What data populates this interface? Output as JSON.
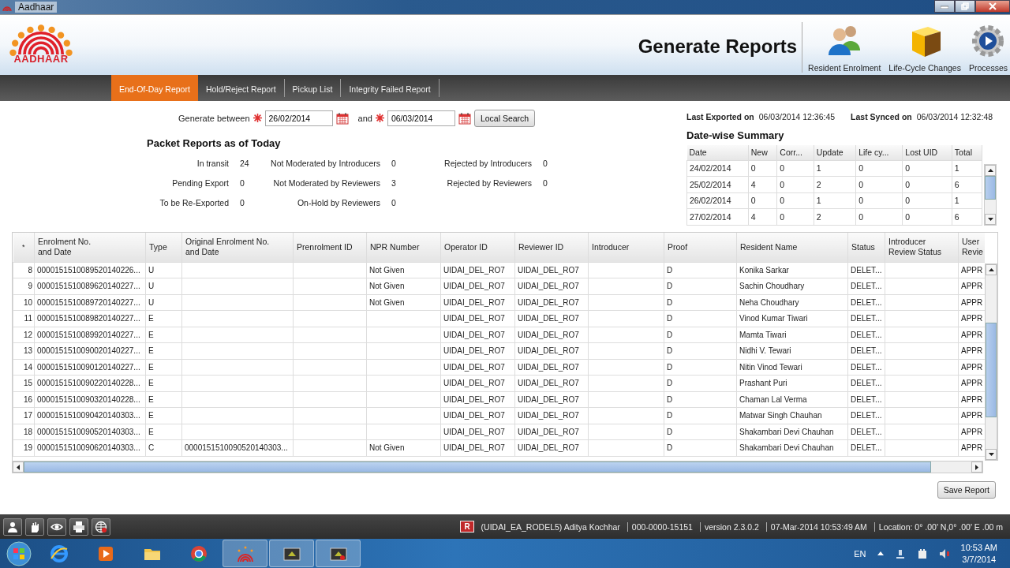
{
  "window": {
    "title": "Aadhaar"
  },
  "header": {
    "logo_text": "AADHAAR",
    "title": "Generate Reports",
    "actions": [
      {
        "kind": "people",
        "label": "Resident Enrolment"
      },
      {
        "kind": "cube",
        "label": "Life-Cycle Changes"
      },
      {
        "kind": "gear",
        "label": "Processes"
      }
    ]
  },
  "tabs": [
    {
      "label": "End-Of-Day Report",
      "selected": true
    },
    {
      "label": "Hold/Reject Report",
      "selected": false
    },
    {
      "label": "Pickup List",
      "selected": false
    },
    {
      "label": "Integrity Failed Report",
      "selected": false
    }
  ],
  "filter": {
    "label": "Generate between",
    "from": "26/02/2014",
    "and_label": "and",
    "to": "06/03/2014",
    "button": "Local Search"
  },
  "export_info": [
    {
      "label": "Last Exported on",
      "value": "06/03/2014 12:36:45"
    },
    {
      "label": "Last Synced on",
      "value": "06/03/2014 12:32:48"
    }
  ],
  "packet_reports": {
    "title": "Packet Reports as of Today",
    "items": [
      {
        "label": "In transit",
        "value": "24"
      },
      {
        "label": "Not Moderated by Introducers",
        "value": "0"
      },
      {
        "label": "Rejected by Introducers",
        "value": "0"
      },
      {
        "label": "Pending Export",
        "value": "0"
      },
      {
        "label": "Not Moderated by Reviewers",
        "value": "3"
      },
      {
        "label": "Rejected by Reviewers",
        "value": "0"
      },
      {
        "label": "To be Re-Exported",
        "value": "0"
      },
      {
        "label": "On-Hold by Reviewers",
        "value": "0"
      }
    ]
  },
  "summary": {
    "title": "Date-wise Summary",
    "columns": [
      "Date",
      "New",
      "Corr...",
      "Update",
      "Life cy...",
      "Lost UID",
      "Total"
    ],
    "rows": [
      [
        "24/02/2014",
        "0",
        "0",
        "1",
        "0",
        "0",
        "1"
      ],
      [
        "25/02/2014",
        "4",
        "0",
        "2",
        "0",
        "0",
        "6"
      ],
      [
        "26/02/2014",
        "0",
        "0",
        "1",
        "0",
        "0",
        "1"
      ],
      [
        "27/02/2014",
        "4",
        "0",
        "2",
        "0",
        "0",
        "6"
      ]
    ]
  },
  "records": {
    "columns": [
      "*",
      "Enrolment No.\nand Date",
      "Type",
      "Original Enrolment No.\nand Date",
      "Prenrolment ID",
      "NPR Number",
      "Operator ID",
      "Reviewer ID",
      "Introducer",
      "Proof",
      "Resident Name",
      "Status",
      "Introducer\nReview Status",
      "User\nRevie"
    ],
    "rows": [
      [
        "8",
        "0000151510089520140226...",
        "U",
        null,
        null,
        "Not Given",
        "UIDAI_DEL_RO7",
        "UIDAI_DEL_RO7",
        null,
        "D",
        "Konika Sarkar",
        "DELET...",
        null,
        "APPR"
      ],
      [
        "9",
        "0000151510089620140227...",
        "U",
        null,
        null,
        "Not Given",
        "UIDAI_DEL_RO7",
        "UIDAI_DEL_RO7",
        null,
        "D",
        "Sachin Choudhary",
        "DELET...",
        null,
        "APPR"
      ],
      [
        "10",
        "0000151510089720140227...",
        "U",
        null,
        null,
        "Not Given",
        "UIDAI_DEL_RO7",
        "UIDAI_DEL_RO7",
        null,
        "D",
        "Neha Choudhary",
        "DELET...",
        null,
        "APPR"
      ],
      [
        "11",
        "0000151510089820140227...",
        "E",
        null,
        null,
        null,
        "UIDAI_DEL_RO7",
        "UIDAI_DEL_RO7",
        null,
        "D",
        "Vinod Kumar Tiwari",
        "DELET...",
        null,
        "APPR"
      ],
      [
        "12",
        "0000151510089920140227...",
        "E",
        null,
        null,
        null,
        "UIDAI_DEL_RO7",
        "UIDAI_DEL_RO7",
        null,
        "D",
        "Mamta Tiwari",
        "DELET...",
        null,
        "APPR"
      ],
      [
        "13",
        "0000151510090020140227...",
        "E",
        null,
        null,
        null,
        "UIDAI_DEL_RO7",
        "UIDAI_DEL_RO7",
        null,
        "D",
        "Nidhi V. Tewari",
        "DELET...",
        null,
        "APPR"
      ],
      [
        "14",
        "0000151510090120140227...",
        "E",
        null,
        null,
        null,
        "UIDAI_DEL_RO7",
        "UIDAI_DEL_RO7",
        null,
        "D",
        "Nitin Vinod Tewari",
        "DELET...",
        null,
        "APPR"
      ],
      [
        "15",
        "0000151510090220140228...",
        "E",
        null,
        null,
        null,
        "UIDAI_DEL_RO7",
        "UIDAI_DEL_RO7",
        null,
        "D",
        "Prashant Puri",
        "DELET...",
        null,
        "APPR"
      ],
      [
        "16",
        "0000151510090320140228...",
        "E",
        null,
        null,
        null,
        "UIDAI_DEL_RO7",
        "UIDAI_DEL_RO7",
        null,
        "D",
        "Chaman Lal Verma",
        "DELET...",
        null,
        "APPR"
      ],
      [
        "17",
        "0000151510090420140303...",
        "E",
        null,
        null,
        null,
        "UIDAI_DEL_RO7",
        "UIDAI_DEL_RO7",
        null,
        "D",
        "Matwar Singh Chauhan",
        "DELET...",
        null,
        "APPR"
      ],
      [
        "18",
        "0000151510090520140303...",
        "E",
        null,
        null,
        null,
        "UIDAI_DEL_RO7",
        "UIDAI_DEL_RO7",
        null,
        "D",
        "Shakambari Devi Chauhan",
        "DELET...",
        null,
        "APPR"
      ],
      [
        "19",
        "0000151510090620140303...",
        "C",
        "0000151510090520140303...",
        null,
        "Not Given",
        "UIDAI_DEL_RO7",
        "UIDAI_DEL_RO7",
        null,
        "D",
        "Shakambari Devi Chauhan",
        "DELET...",
        null,
        "APPR"
      ]
    ]
  },
  "save_button": "Save Report",
  "status_bar": {
    "badge": "R",
    "fields": [
      "(UIDAI_EA_RODEL5) Aditya Kochhar",
      "000-0000-15151",
      "version 2.3.0.2",
      "07-Mar-2014 10:53:49 AM",
      "Location: 0° .00' N,0° .00' E .00 m"
    ]
  },
  "taskbar": {
    "language": "EN",
    "time": "10:53 AM",
    "date": "3/7/2014"
  }
}
